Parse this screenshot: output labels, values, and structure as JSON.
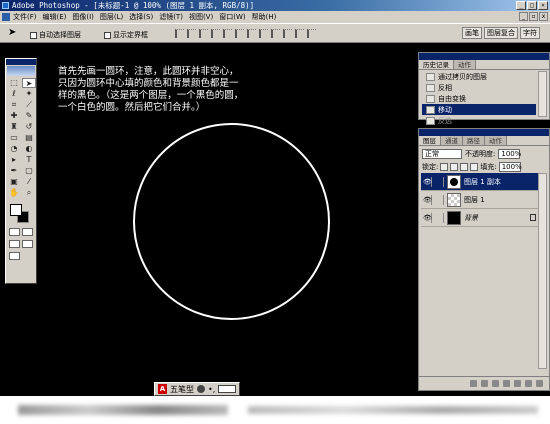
{
  "window": {
    "title": "Adobe Photoshop - [未标题-1 @ 100% (图层 1 副本, RGB/8)]",
    "controls": [
      "_",
      "□",
      "×"
    ]
  },
  "menu": {
    "items": [
      "文件(F)",
      "编辑(E)",
      "图像(I)",
      "图层(L)",
      "选择(S)",
      "滤镜(T)",
      "视图(V)",
      "窗口(W)",
      "帮助(H)"
    ]
  },
  "options": {
    "auto_select": "自动选择图层",
    "show_bounds": "显示定界框",
    "palette_tabs": [
      "画笔",
      "图层复合",
      "字符"
    ]
  },
  "canvas": {
    "instructions": [
      "首先先画一圆环，注意，此圆环并非空心，",
      "只因为圆环中心填的颜色和背景颜色都是一",
      "样的黑色。（这是两个图层，一个黑色的圆，",
      "一个白色的圆。然后把它们合并。）"
    ]
  },
  "history": {
    "tabs": [
      "历史记录",
      "动作"
    ],
    "items": [
      {
        "label": "通过拷贝的图层",
        "selected": false,
        "dim": false
      },
      {
        "label": "反相",
        "selected": false,
        "dim": false
      },
      {
        "label": "自由变换",
        "selected": false,
        "dim": false
      },
      {
        "label": "移动",
        "selected": true,
        "dim": false
      },
      {
        "label": "反选",
        "selected": false,
        "dim": true
      }
    ]
  },
  "layers": {
    "tabs": [
      "图层",
      "通道",
      "路径",
      "动作"
    ],
    "blend_mode": "正常",
    "opacity_label": "不透明度:",
    "opacity_value": "100%",
    "lock_label": "锁定:",
    "fill_label": "填充:",
    "fill_value": "100%",
    "items": [
      {
        "name": "图层 1 副本",
        "selected": true
      },
      {
        "name": "图层 1",
        "selected": false
      },
      {
        "name": "背景",
        "selected": false
      }
    ]
  },
  "ime": {
    "mode": "五笔型"
  }
}
